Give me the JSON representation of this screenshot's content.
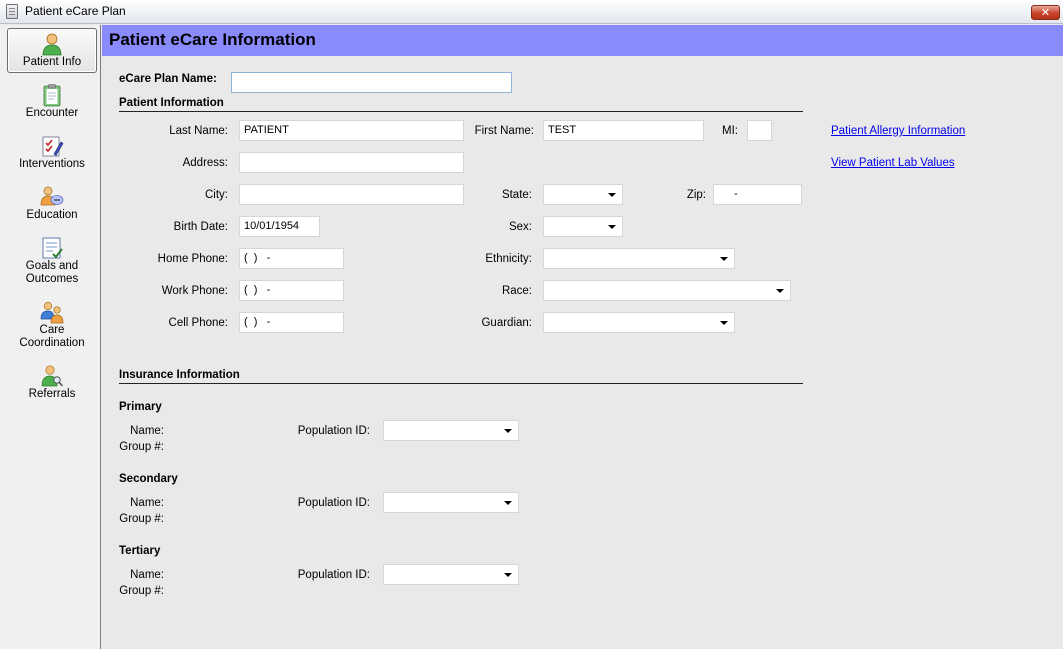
{
  "window": {
    "title": "Patient eCare Plan",
    "close_label": "✕"
  },
  "sidebar": {
    "items": [
      {
        "label": "Patient Info"
      },
      {
        "label": "Encounter"
      },
      {
        "label": "Interventions"
      },
      {
        "label": "Education"
      },
      {
        "label": "Goals and Outcomes"
      },
      {
        "label": "Care Coordination"
      },
      {
        "label": "Referrals"
      }
    ]
  },
  "header": {
    "title": "Patient eCare Information"
  },
  "form": {
    "plan_name_label": "eCare Plan Name:",
    "plan_name_value": "",
    "patient_section": "Patient Information",
    "last_name_label": "Last Name:",
    "last_name_value": "PATIENT",
    "first_name_label": "First Name:",
    "first_name_value": "TEST",
    "mi_label": "MI:",
    "mi_value": "",
    "address_label": "Address:",
    "address_value": "",
    "city_label": "City:",
    "city_value": "",
    "state_label": "State:",
    "state_value": "",
    "zip_label": "Zip:",
    "zip_value": "-",
    "birth_date_label": "Birth Date:",
    "birth_date_value": "10/01/1954",
    "sex_label": "Sex:",
    "sex_value": "",
    "home_phone_label": "Home Phone:",
    "home_phone_value": "(  )   -",
    "work_phone_label": "Work Phone:",
    "work_phone_value": "(  )   -",
    "cell_phone_label": "Cell Phone:",
    "cell_phone_value": "(  )   -",
    "ethnicity_label": "Ethnicity:",
    "ethnicity_value": "",
    "race_label": "Race:",
    "race_value": "",
    "guardian_label": "Guardian:",
    "guardian_value": "",
    "allergy_link": "Patient Allergy Information",
    "lab_link": "View Patient Lab Values"
  },
  "insurance": {
    "section": "Insurance Information",
    "name_label": "Name:",
    "group_label": "Group #:",
    "population_label": "Population ID:",
    "plans": [
      {
        "title": "Primary",
        "population_value": ""
      },
      {
        "title": "Secondary",
        "population_value": ""
      },
      {
        "title": "Tertiary",
        "population_value": ""
      }
    ]
  }
}
